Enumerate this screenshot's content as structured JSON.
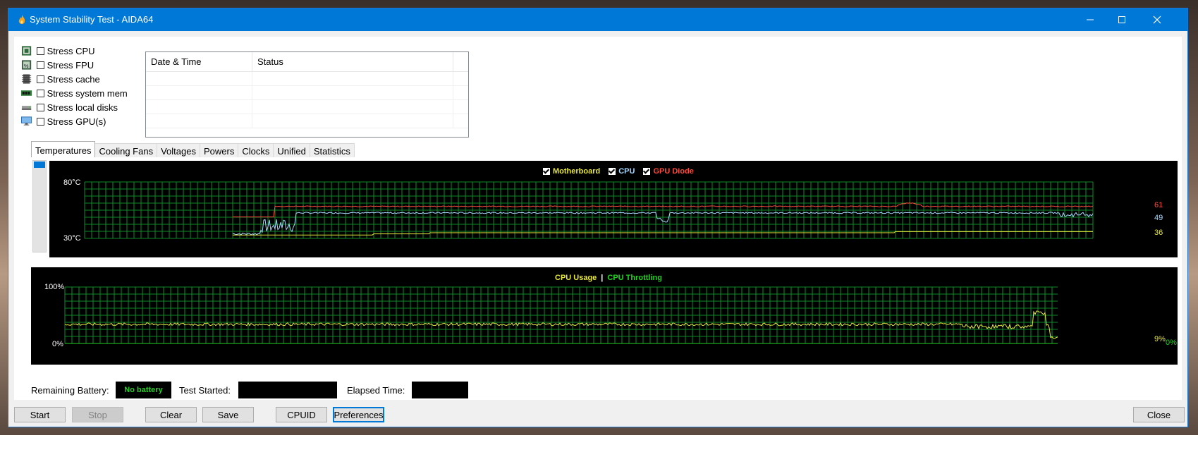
{
  "window": {
    "title": "System Stability Test - AIDA64"
  },
  "stress": [
    {
      "label": "Stress CPU",
      "icon": "cpu-chip-icon"
    },
    {
      "label": "Stress FPU",
      "icon": "fpu-chip-icon"
    },
    {
      "label": "Stress cache",
      "icon": "cache-icon"
    },
    {
      "label": "Stress system memory",
      "icon": "memory-module-icon"
    },
    {
      "label": "Stress local disks",
      "icon": "disk-drive-icon"
    },
    {
      "label": "Stress GPU(s)",
      "icon": "monitor-icon"
    }
  ],
  "log": {
    "col_datetime": "Date & Time",
    "col_status": "Status"
  },
  "tabs": [
    "Temperatures",
    "Cooling Fans",
    "Voltages",
    "Powers",
    "Clocks",
    "Unified",
    "Statistics"
  ],
  "temp_graph": {
    "legend": [
      {
        "label": "Motherboard",
        "color": "#e8e83c"
      },
      {
        "label": "CPU",
        "color": "#a8d8ff"
      },
      {
        "label": "GPU Diode",
        "color": "#ff4a3c"
      }
    ],
    "y_top": "80°C",
    "y_bottom": "30°C",
    "current": {
      "gpu": "61",
      "cpu": "49",
      "motherboard": "36"
    }
  },
  "usage_graph": {
    "legend_usage": "CPU Usage",
    "separator": "|",
    "legend_throttling": "CPU Throttling",
    "y_top": "100%",
    "y_bottom": "0%",
    "current_usage": "9%",
    "current_throttling": "0%"
  },
  "status": {
    "battery_label": "Remaining Battery:",
    "battery_value": "No battery",
    "started_label": "Test Started:",
    "elapsed_label": "Elapsed Time:"
  },
  "buttons": {
    "start": "Start",
    "stop": "Stop",
    "clear": "Clear",
    "save": "Save",
    "cpuid": "CPUID",
    "preferences": "Preferences",
    "close": "Close"
  },
  "colors": {
    "titlebar": "#0078d7",
    "grid": "#0f8a2a",
    "motherboard": "#e8e83c",
    "cpu": "#a8d8ff",
    "gpu": "#ff4a3c",
    "usage": "#e8e83c",
    "throttling": "#22d422"
  }
}
